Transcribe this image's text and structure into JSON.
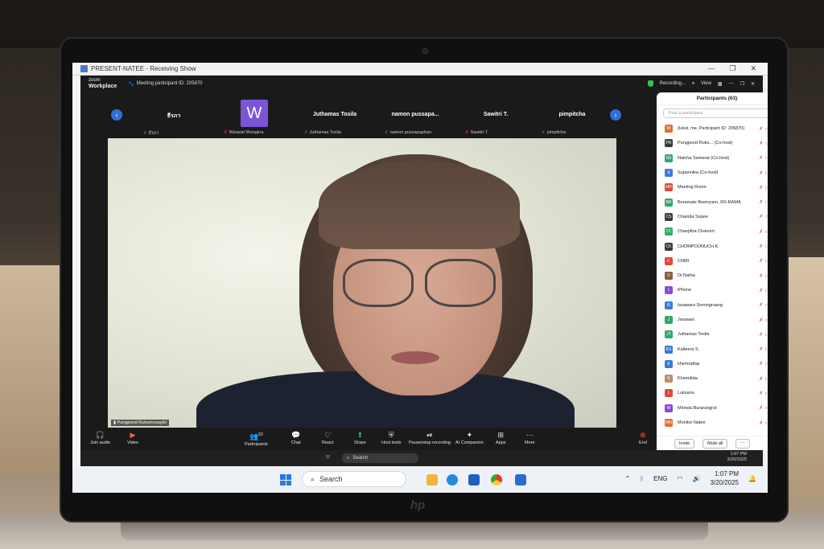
{
  "window": {
    "title": "PRESENT-NATEE - Receiving Show",
    "controls": [
      "—",
      "❐",
      "✕"
    ]
  },
  "zoom": {
    "brand_top": "zoom",
    "brand_bottom": "Workplace",
    "meeting_id": "Meeting participant ID: 205870",
    "recording": "Recording...",
    "view_label": "View"
  },
  "gallery": [
    {
      "big": "ธีรภา",
      "small": "ธีรภา"
    },
    {
      "big": "W",
      "small": "Wararat Wongkra"
    },
    {
      "big": "Juthamas Tosila",
      "small": "Juthamas Tosila"
    },
    {
      "big": "namon pussapa...",
      "small": "namon pussapaphan"
    },
    {
      "big": "Sawitri T.",
      "small": "Sawitri T."
    },
    {
      "big": "pimpitcha",
      "small": "pimpitcha"
    }
  ],
  "speaker": {
    "name": "Pungpond Rukumnuaykit"
  },
  "toolbar": {
    "join_audio": "Join audio",
    "video": "Video",
    "participants": "Participants",
    "participants_count": "63",
    "chat": "Chat",
    "react": "React",
    "share": "Share",
    "host_tools": "Host tools",
    "recording": "Pause/stop recording",
    "ai": "AI Companion",
    "apps": "Apps",
    "more": "More",
    "end": "End"
  },
  "panel": {
    "title": "Participants (63)",
    "search_placeholder": "Find a participant",
    "invite": "Invite",
    "mute_all": "Mute all",
    "participants": [
      {
        "initials": "M",
        "name": "(Host, me, Participant ID: 205870)",
        "color": "#e0703a"
      },
      {
        "initials": "PR",
        "name": "Pungpond Ruku... (Co-host)",
        "color": "#3a3a3a"
      },
      {
        "initials": "NS",
        "name": "Natcha Semerat (Co-host)",
        "color": "#2ea86b"
      },
      {
        "initials": "S",
        "name": "Supannika (Co-host)",
        "color": "#3a7ad9"
      },
      {
        "initials": "MR",
        "name": "Meeting Room",
        "color": "#d94a3a"
      },
      {
        "initials": "BR",
        "name": "Boramate Boonyuen, RS-RAMA",
        "color": "#2ea86b"
      },
      {
        "initials": "CS",
        "name": "Chanida Sopee",
        "color": "#3a3a3a"
      },
      {
        "initials": "CC",
        "name": "Chanjittra Chanom",
        "color": "#2ea86b"
      },
      {
        "initials": "CK",
        "name": "CHOMPOONUCH K.",
        "color": "#3a3a3a"
      },
      {
        "initials": "C",
        "name": "CNMI",
        "color": "#d94a3a"
      },
      {
        "initials": "D",
        "name": "Dr.Natha",
        "color": "#8a5a40"
      },
      {
        "initials": "I",
        "name": "iPhone",
        "color": "#8a4ad9"
      },
      {
        "initials": "IS",
        "name": "Issawara Sinningruang",
        "color": "#3a7ad9"
      },
      {
        "initials": "J",
        "name": "Jarawan",
        "color": "#2ea86b"
      },
      {
        "initials": "JT",
        "name": "Juthamas Tosila",
        "color": "#2ea86b"
      },
      {
        "initials": "KS",
        "name": "Kalteera S.",
        "color": "#3a7ad9"
      },
      {
        "initials": "K",
        "name": "khemrathai",
        "color": "#3a7ad9"
      },
      {
        "initials": "K",
        "name": "Khemdida",
        "color": "#c08a6a"
      },
      {
        "initials": "L",
        "name": "Luksana",
        "color": "#d94a3a"
      },
      {
        "initials": "M",
        "name": "Mirinda Burarungrot",
        "color": "#8a4ad9"
      },
      {
        "initials": "MN",
        "name": "Monitor Natee",
        "color": "#e0703a"
      }
    ]
  },
  "remote_taskbar": {
    "search": "Search",
    "time": "1:07 PM",
    "date": "3/20/2025"
  },
  "local_taskbar": {
    "search": "Search",
    "lang": "ENG",
    "time": "1:07 PM",
    "date": "3/20/2025"
  },
  "laptop": {
    "logo": "hp"
  }
}
